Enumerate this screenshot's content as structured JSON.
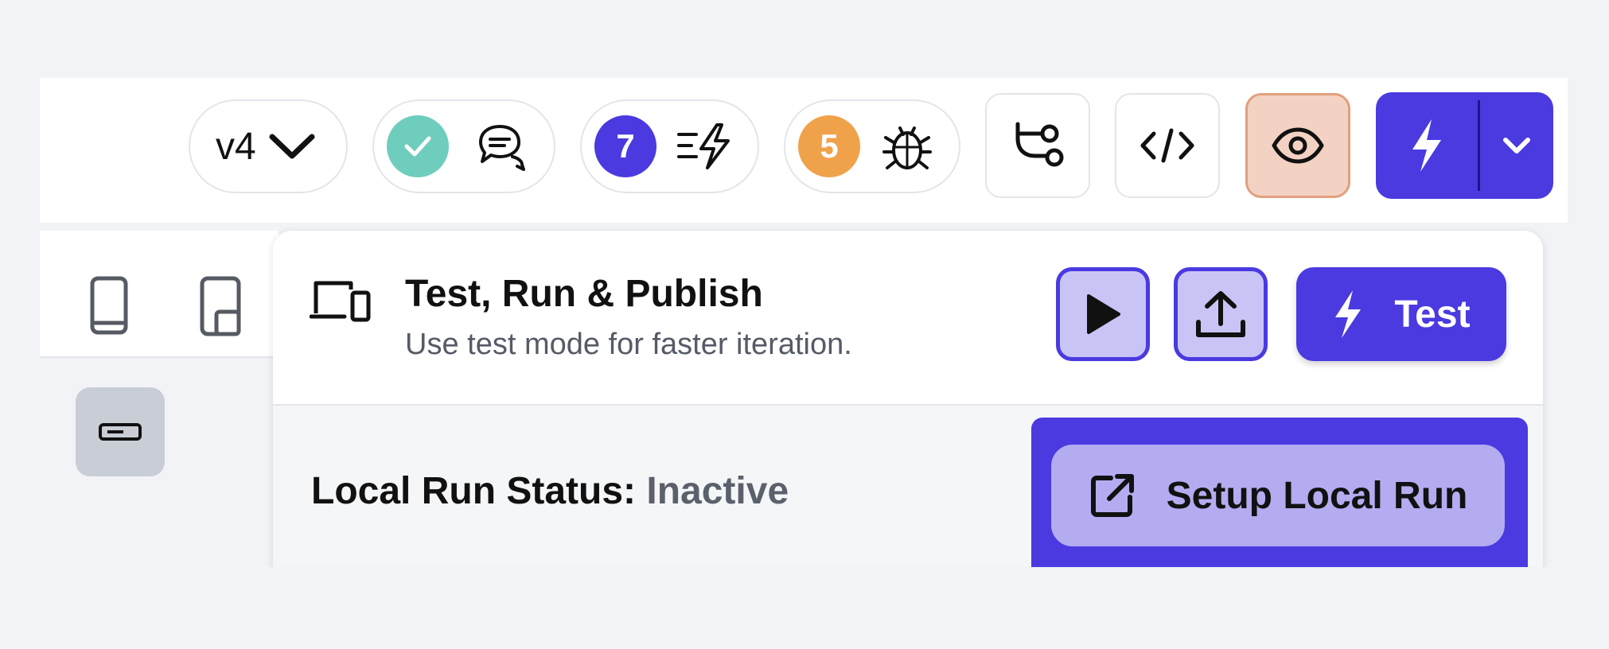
{
  "toolbar": {
    "version_label": "v4",
    "branch_count": "7",
    "bug_count": "5",
    "colors": {
      "check": "#6fcdbe",
      "branches": "#4a3ae0",
      "bugs": "#f0a24a",
      "preview_bg": "#f4d2c3",
      "preview_border": "#e0a07f",
      "primary": "#4a3ae0"
    }
  },
  "menu": {
    "title": "Test, Run & Publish",
    "subtitle": "Use test mode for faster iteration.",
    "test_label": "Test",
    "status_label": "Local Run Status:",
    "status_value": "Inactive",
    "setup_label": "Setup Local Run"
  }
}
